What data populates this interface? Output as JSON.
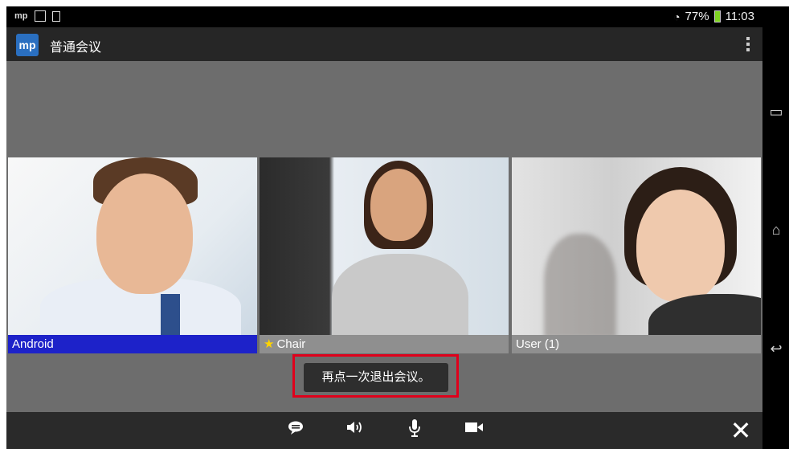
{
  "statusbar": {
    "app_badge": "mp",
    "battery_percent": "77%",
    "time": "11:03",
    "wifi_icon": "wifi-icon",
    "battery_color": "#7ed321"
  },
  "actionbar": {
    "app_icon_text": "mp",
    "title": "普通会议"
  },
  "participants": [
    {
      "name": "Android",
      "label_color": "#1d22c9"
    },
    {
      "name": "Chair",
      "role_icon": "star-icon",
      "label_color": "#8f8f8f"
    },
    {
      "name": "User (1)",
      "label_color": "#8f8f8f"
    }
  ],
  "toast": {
    "text": "再点一次退出会议。",
    "highlight_color": "#e0001b"
  },
  "toolbar": {
    "items": [
      {
        "icon": "chat-icon"
      },
      {
        "icon": "speaker-icon"
      },
      {
        "icon": "microphone-icon"
      },
      {
        "icon": "camera-icon"
      },
      {
        "icon": "close-icon"
      }
    ]
  },
  "navbar": {
    "items": [
      "recent-apps-icon",
      "home-icon",
      "back-icon"
    ]
  }
}
